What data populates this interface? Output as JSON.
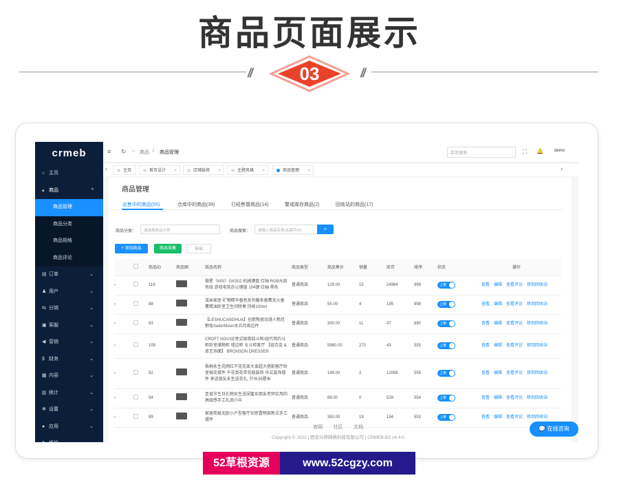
{
  "hero": {
    "title": "商品页面展示",
    "badge": "03",
    "slashes": "//"
  },
  "sidebar": {
    "logo": "crmeb",
    "items": [
      {
        "icon": "⌂",
        "label": "主页"
      },
      {
        "icon": "▴",
        "label": "商品",
        "chev": "^"
      },
      {
        "icon": "▤",
        "label": "订单",
        "chev": "⌄"
      },
      {
        "icon": "♟",
        "label": "用户",
        "chev": "⌄"
      },
      {
        "icon": "⇆",
        "label": "分销",
        "chev": "⌄"
      },
      {
        "icon": "▣",
        "label": "客服",
        "chev": "⌄"
      },
      {
        "icon": "◀",
        "label": "营销",
        "chev": "⌄"
      },
      {
        "icon": "$",
        "label": "财务",
        "chev": "⌄"
      },
      {
        "icon": "▦",
        "label": "内容",
        "chev": "⌄"
      },
      {
        "icon": "▥",
        "label": "统计",
        "chev": "⌄"
      },
      {
        "icon": "✻",
        "label": "设置",
        "chev": "⌄"
      },
      {
        "icon": "●",
        "label": "应用",
        "chev": "⌄"
      },
      {
        "icon": "✎",
        "label": "维护",
        "chev": "⌄"
      }
    ],
    "sub_items": [
      "商品管理",
      "商品分类",
      "商品规格",
      "商品评论"
    ]
  },
  "topbar": {
    "menu_icon": "≡",
    "refresh_icon": "↻",
    "home_icon": "⌂",
    "bc_root": "商品",
    "bc_sep": "/",
    "bc_current": "商品管理",
    "search_placeholder": "菜单搜索",
    "fullscreen_icon": "⛶",
    "bell_icon": "🔔",
    "user": "demo"
  },
  "tabs": [
    {
      "label": "主页"
    },
    {
      "label": "首页设计"
    },
    {
      "label": "店铺装修"
    },
    {
      "label": "主题风格"
    },
    {
      "label": "商品管理"
    }
  ],
  "tab_close": "×",
  "page": {
    "title": "商品管理",
    "subtabs": [
      "出售中的商品(55)",
      "仓库中的商品(39)",
      "已经售罄商品(14)",
      "警戒库存商品(2)",
      "回收站的商品(17)"
    ],
    "filter_cat_label": "商品分类：",
    "filter_cat_placeholder": "请选择商品分类",
    "filter_search_label": "商品搜索：",
    "filter_search_placeholder": "请输入商品名称/关键字/ID",
    "btn_add": "+ 添加商品",
    "btn_collect": "商品采集",
    "btn_export": "导出"
  },
  "table": {
    "headers": [
      "",
      "",
      "商品ID",
      "商品图",
      "商品名称",
      "商品类型",
      "商品售价",
      "销量",
      "库存",
      "排序",
      "状态",
      "操作"
    ],
    "rows": [
      {
        "id": "119",
        "name": "微星（MSI）GK50Z 机械键盘 红轴 RGB光效 有线 游戏电竞办公键盘 104键 红轴 黑色",
        "type": "普通商品",
        "price": "129.00",
        "sales": "15",
        "stock": "24984",
        "sort": "999"
      },
      {
        "id": "88",
        "name": "诺米家居 矿物精华香氛系列藤条香薰无火香薰精油卧室卫生间除臭 持续100ml",
        "type": "普通商品",
        "price": "55.00",
        "sales": "4",
        "stock": "195",
        "sort": "998"
      },
      {
        "id": "93",
        "name": "【LESHUCANGHUA】创意陶瓷动漫人物月野兔SailorMoon水兵月周边件",
        "type": "普通商品",
        "price": "300.00",
        "sales": "11",
        "stock": "47",
        "sort": "890"
      },
      {
        "id": "109",
        "name": "CROFT HOUSE意式极简四斗柜/现代简约斗柜卧室储物柜 墙边柜 五斗柜客厅 【组合金 & 皮艺饰面】 BRONSON DRESSER",
        "type": "普通商品",
        "price": "5980.00",
        "sales": "272",
        "stock": "43",
        "sort": "555"
      },
      {
        "id": "92",
        "name": "梧桐永生花网红干花花束大束超大搭配客厅卧室插花摆件 干花真花带花瓶装饰 中式装饰摆件 来送朋友永生送花礼, 针长35厘米",
        "type": "普通商品",
        "price": "149.00",
        "sales": "2",
        "stock": "12098",
        "sort": "555"
      },
      {
        "id": "94",
        "name": "圣诞节生日礼物女生送闺蜜女朋友老师实用的高级感手工礼品小众",
        "type": "普通商品",
        "price": "89.00",
        "sales": "0",
        "stock": "528",
        "sort": "554"
      },
      {
        "id": "89",
        "name": "家居简易北欧小户型客厅创意置物架新式手工摆件",
        "type": "普通商品",
        "price": "350.00",
        "sales": "19",
        "stock": "194",
        "sort": "553"
      }
    ],
    "status_label": "上架",
    "actions": [
      "查看",
      "编辑",
      "查看评论",
      "移到回收站"
    ]
  },
  "footer": {
    "links": [
      "官网",
      "社区",
      "文档"
    ],
    "copyright": "Copyright © 2022 | 西安众邦网络科技有限公司 | CRMEB-BZ v4.4.0"
  },
  "chat": {
    "label": "在线咨询",
    "icon": "💬"
  },
  "watermark": {
    "left": "52草根资源",
    "right": "www.52cgzy.com"
  }
}
